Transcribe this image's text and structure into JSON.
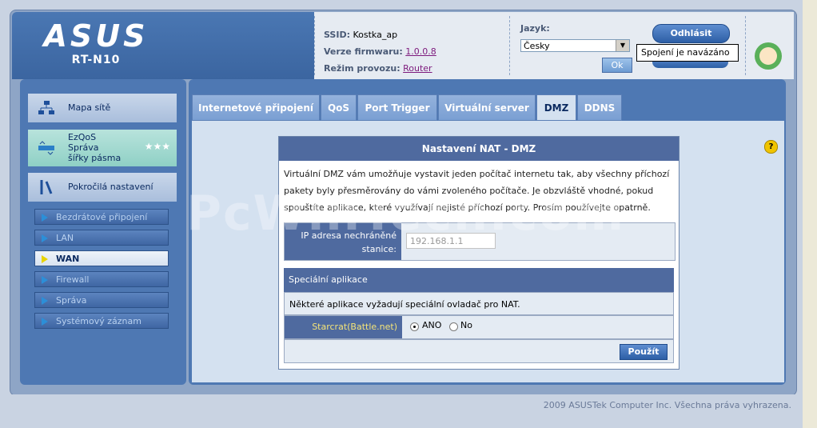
{
  "brand": {
    "logo": "ASUS",
    "model": "RT-N10"
  },
  "info": {
    "ssid_label": "SSID:",
    "ssid_value": "Kostka_ap",
    "firmware_label": "Verze firmwaru:",
    "firmware_value": "1.0.0.8",
    "mode_label": "Režim provozu:",
    "mode_value": "Router"
  },
  "language": {
    "label": "Jazyk:",
    "selected": "Česky",
    "ok_label": "Ok"
  },
  "header_right": {
    "logout_label": "Odhlásit",
    "tooltip": "Spojení je navázáno"
  },
  "sidebar": {
    "items": [
      {
        "label": "Mapa sítě",
        "icon": "network-map-icon"
      },
      {
        "label_lines": [
          "EzQoS",
          "Správa",
          "šířky pásma"
        ],
        "icon": "ezqos-icon"
      },
      {
        "label": "Pokročilá nastavení",
        "icon": "tools-icon"
      }
    ],
    "subitems": [
      {
        "label": "Bezdrátové připojení"
      },
      {
        "label": "LAN"
      },
      {
        "label": "WAN"
      },
      {
        "label": "Firewall"
      },
      {
        "label": "Správa"
      },
      {
        "label": "Systémový záznam"
      }
    ],
    "active_subitem": "WAN"
  },
  "tabs": [
    {
      "label": "Internetové připojení"
    },
    {
      "label": "QoS"
    },
    {
      "label": "Port Trigger"
    },
    {
      "label": "Virtuální server"
    },
    {
      "label": "DMZ"
    },
    {
      "label": "DDNS"
    }
  ],
  "active_tab": "DMZ",
  "panel": {
    "title": "Nastavení NAT - DMZ",
    "description": "Virtuální DMZ vám umožňuje vystavit jeden počítač internetu tak, aby všechny příchozí pakety byly přesměrovány do vámi zvoleného počítače. Je obzvláště vhodné, pokud spouštíte aplikace, které využívají nejisté příchozí porty. Prosím používejte opatrně.",
    "ip_label_lines": [
      "IP adresa nechráněné",
      "stanice:"
    ],
    "ip_value": "192.168.1.1",
    "special_title": "Speciální aplikace",
    "special_desc": "Některé aplikace vyžadují speciální ovladač pro NAT.",
    "app_label": "Starcrat(Battle.net)",
    "radio_yes": "ANO",
    "radio_no": "No",
    "radio_selected": "ANO",
    "apply_label": "Použít"
  },
  "help_icon": "?",
  "watermark": "PcWinTech.com",
  "footer": {
    "copyright": "2009 ASUSTek Computer Inc. Všechna práva vyhrazena."
  }
}
